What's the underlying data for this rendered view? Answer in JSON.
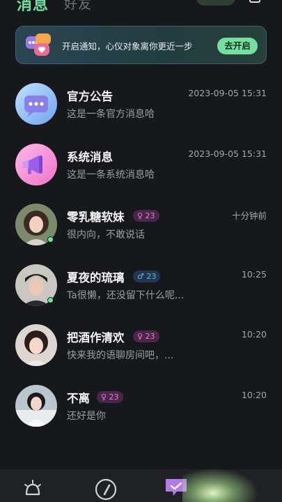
{
  "header": {
    "tab_active": "消息",
    "tab_inactive": "好友"
  },
  "banner": {
    "text": "开启通知，心仪对象离你更近一步",
    "button_label": "去开启"
  },
  "conversations": [
    {
      "name": "官方公告",
      "message": "这是一条官方消息哈",
      "time": "2023-09-05  15:31"
    },
    {
      "name": "系统消息",
      "message": "这是一条系统消息哈",
      "time": "2023-09-05  15:31"
    },
    {
      "name": "零乳糖软妹",
      "badge": "♀ 23",
      "message": "很内向，不敢说话",
      "time": "十分钟前"
    },
    {
      "name": "夏夜的琉璃",
      "badge": "♂ 23",
      "message": "Ta很懒，还没留下什么呢...",
      "time": "10:25"
    },
    {
      "name": "把酒作清欢",
      "badge": "♀ 23",
      "message": "快来我的语聊房间吧，...",
      "time": "10:20"
    },
    {
      "name": "不离",
      "badge": "♀ 23",
      "message": "还好是你",
      "time": "10:20"
    }
  ],
  "icons": {
    "banner": "chat-bubbles-heart-icon",
    "official": "chat-bubble-dots-icon",
    "system": "megaphone-icon",
    "nav_home": "bell-icon",
    "nav_discover": "compass-icon",
    "nav_messages": "message-icon"
  },
  "colors": {
    "accent": "#74e09e",
    "background": "#16181b",
    "female_badge": "#e77bd8",
    "male_badge": "#6fb3ef",
    "online": "#6fe49b"
  }
}
